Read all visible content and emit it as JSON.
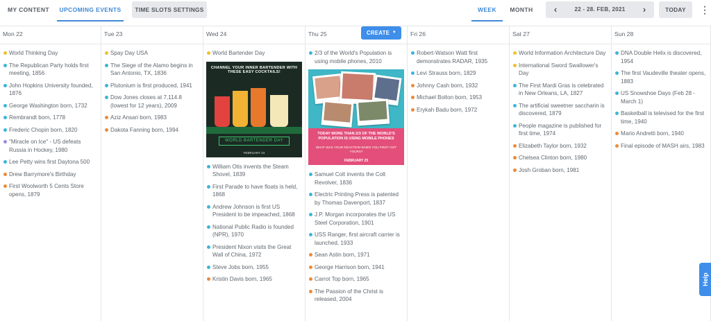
{
  "nav": {
    "tab_content": "MY CONTENT",
    "tab_events": "UPCOMING EVENTS",
    "slots_button": "TIME SLOTS SETTINGS",
    "view_week": "WEEK",
    "view_month": "MONTH",
    "date_range": "22 - 28. FEB, 2021",
    "today_button": "TODAY",
    "prev_icon": "chevron-left-icon",
    "next_icon": "chevron-right-icon",
    "menu_icon": "kebab-menu-icon"
  },
  "create_button": "CREATE",
  "help_label": "Help",
  "colors": {
    "accent": "#3e88d6",
    "yellow": "#efc12a",
    "blue": "#3cb5d9",
    "orange": "#ed8a3a",
    "purple": "#a08adf"
  },
  "days": [
    {
      "label": "Mon 22",
      "events": [
        {
          "text": "World Thinking Day",
          "color": "yellow"
        },
        {
          "text": "The Republican Party holds first meeting, 1856",
          "color": "blue"
        },
        {
          "text": "John Hopkins University founded, 1876",
          "color": "blue"
        },
        {
          "text": "George Washington born, 1732",
          "color": "blue"
        },
        {
          "text": "Rembrandt born, 1778",
          "color": "blue"
        },
        {
          "text": "Frederic Chopin born, 1820",
          "color": "blue"
        },
        {
          "text": "\"Miracle on Ice\" - US defeats Russia in Hockey, 1980",
          "color": "purple"
        },
        {
          "text": "Lee Petty wins first Daytona 500",
          "color": "blue"
        },
        {
          "text": "Drew Barrymore's Birthday",
          "color": "orange"
        },
        {
          "text": "First Woolworth 5 Cents Store opens, 1879",
          "color": "orange"
        }
      ]
    },
    {
      "label": "Tue 23",
      "events": [
        {
          "text": "Spay Day USA",
          "color": "yellow"
        },
        {
          "text": "The Siege of the Alamo begins in San Antonio, TX, 1836",
          "color": "blue"
        },
        {
          "text": "Plutonium is first produced, 1941",
          "color": "blue"
        },
        {
          "text": "Dow Jones closes at 7,114.8 (lowest for 12 years), 2009",
          "color": "blue"
        },
        {
          "text": "Aziz Ansari born, 1983",
          "color": "orange"
        },
        {
          "text": "Dakota Fanning born, 1994",
          "color": "orange"
        }
      ]
    },
    {
      "label": "Wed 24",
      "events": [
        {
          "text": "World Bartender Day",
          "color": "yellow"
        }
      ],
      "image": {
        "caption": "CHANNEL YOUR INNER BARTENDER WITH THESE EASY COCKTAILS!",
        "banner": "WORLD BARTENDER DAY",
        "footer": "FEBRUARY 24"
      },
      "events_after": [
        {
          "text": "William Otis invents the Steam Shovel, 1839",
          "color": "blue"
        },
        {
          "text": "First Parade to have floats is held, 1868",
          "color": "blue"
        },
        {
          "text": "Andrew Johnson is first US President to be impeached, 1868",
          "color": "blue"
        },
        {
          "text": "National Public Radio is founded (NPR), 1970",
          "color": "blue"
        },
        {
          "text": "President Nixon visits the Great Wall of China, 1972",
          "color": "blue"
        },
        {
          "text": "Steve Jobs born, 1955",
          "color": "blue"
        },
        {
          "text": "Kristin Davis born, 1965",
          "color": "orange"
        }
      ]
    },
    {
      "label": "Thu 25",
      "events": [
        {
          "text": "2/3 of the World's Population is using mobile phones, 2010",
          "color": "blue"
        }
      ],
      "image": {
        "title": "TODAY MORE THAN 2/3 OF THE WORLD'S POPULATION IS USING MOBILE PHONES",
        "subtitle": "WHAT WAS YOUR REACTION WHEN YOU FIRST GOT YOURS?",
        "footer": "FEBRUARY 25"
      },
      "events_after": [
        {
          "text": "Samuel Colt invents the Colt Revolver, 1836",
          "color": "blue"
        },
        {
          "text": "Electric Printing Press is patented by Thomas Davenport, 1837",
          "color": "blue"
        },
        {
          "text": "J.P. Morgan incorporates the US Steel Corporation, 1901",
          "color": "blue"
        },
        {
          "text": "USS Ranger, first aircraft carrier is launched, 1933",
          "color": "blue"
        },
        {
          "text": "Sean Astin born, 1971",
          "color": "orange"
        },
        {
          "text": "George Harrison born, 1941",
          "color": "orange"
        },
        {
          "text": "Carrot Top born, 1965",
          "color": "orange"
        },
        {
          "text": "The Passion of the Christ is released, 2004",
          "color": "orange"
        }
      ]
    },
    {
      "label": "Fri 26",
      "events": [
        {
          "text": "Robert-Watson Watt first demonstrates RADAR, 1935",
          "color": "blue"
        },
        {
          "text": "Levi Strauss born, 1829",
          "color": "blue"
        },
        {
          "text": "Johnny Cash born, 1932",
          "color": "orange"
        },
        {
          "text": "Michael Bolton born, 1953",
          "color": "orange"
        },
        {
          "text": "Erykah Badu born, 1972",
          "color": "orange"
        }
      ]
    },
    {
      "label": "Sat 27",
      "events": [
        {
          "text": "World Information Architecture Day",
          "color": "yellow"
        },
        {
          "text": "International Sword Swallower's Day",
          "color": "yellow"
        },
        {
          "text": "The First Mardi Gras is celebrated in New Orleans, LA, 1827",
          "color": "blue"
        },
        {
          "text": "The artificial sweetner saccharin is discovered, 1879",
          "color": "blue"
        },
        {
          "text": "People magazine is published for first time, 1974",
          "color": "blue"
        },
        {
          "text": "Elizabeth Taylor born, 1932",
          "color": "orange"
        },
        {
          "text": "Chelsea Clinton born, 1980",
          "color": "orange"
        },
        {
          "text": "Josh Groban born, 1981",
          "color": "orange"
        }
      ]
    },
    {
      "label": "Sun 28",
      "events": [
        {
          "text": "DNA Double Helix is discovered, 1954",
          "color": "blue"
        },
        {
          "text": "The first Vaudeville theater opens, 1883",
          "color": "blue"
        },
        {
          "text": "US Snowshoe Days (Feb 28 - March 1)",
          "color": "blue"
        },
        {
          "text": "Basketball is televised for the first time, 1940",
          "color": "blue"
        },
        {
          "text": "Mario Andretti born, 1940",
          "color": "orange"
        },
        {
          "text": "Final episode of MASH airs, 1983",
          "color": "orange"
        }
      ]
    }
  ]
}
